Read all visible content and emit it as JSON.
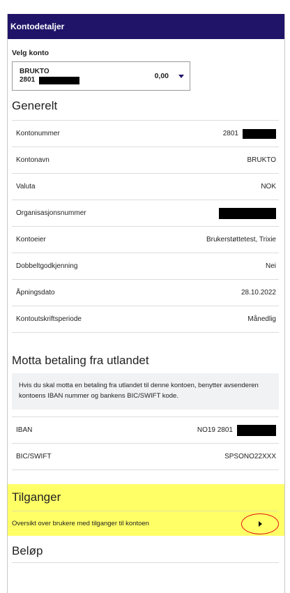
{
  "header": {
    "title": "Kontodetaljer"
  },
  "account_select": {
    "label": "Velg konto",
    "name": "BRUKTO",
    "number": "2801",
    "balance": "0,00"
  },
  "general": {
    "title": "Generelt",
    "rows": [
      {
        "label": "Kontonummer",
        "value": "2801",
        "redacted": true
      },
      {
        "label": "Kontonavn",
        "value": "BRUKTO"
      },
      {
        "label": "Valuta",
        "value": "NOK"
      },
      {
        "label": "Organisasjonsnummer",
        "value": "",
        "redacted": true
      },
      {
        "label": "Kontoeier",
        "value": "Brukerstøttetest, Trixie"
      },
      {
        "label": "Dobbeltgodkjenning",
        "value": "Nei"
      },
      {
        "label": "Åpningsdato",
        "value": "28.10.2022"
      },
      {
        "label": "Kontoutskriftsperiode",
        "value": "Månedlig"
      }
    ]
  },
  "foreign_payment": {
    "title": "Motta betaling fra utlandet",
    "info": "Hvis du skal motta en betaling fra utlandet til denne kontoen, benytter avsenderen kontoens IBAN nummer og bankens BIC/SWIFT kode.",
    "rows": [
      {
        "label": "IBAN",
        "value": "NO19 2801",
        "redacted": true
      },
      {
        "label": "BIC/SWIFT",
        "value": "SPSONO22XXX"
      }
    ]
  },
  "access": {
    "title": "Tilganger",
    "link_text": "Oversikt over brukere med tilganger til kontoen"
  },
  "amount": {
    "title": "Beløp"
  },
  "colors": {
    "header_bg": "#1f1468",
    "highlight": "#ffff66",
    "annotation_circle": "#e01010"
  }
}
